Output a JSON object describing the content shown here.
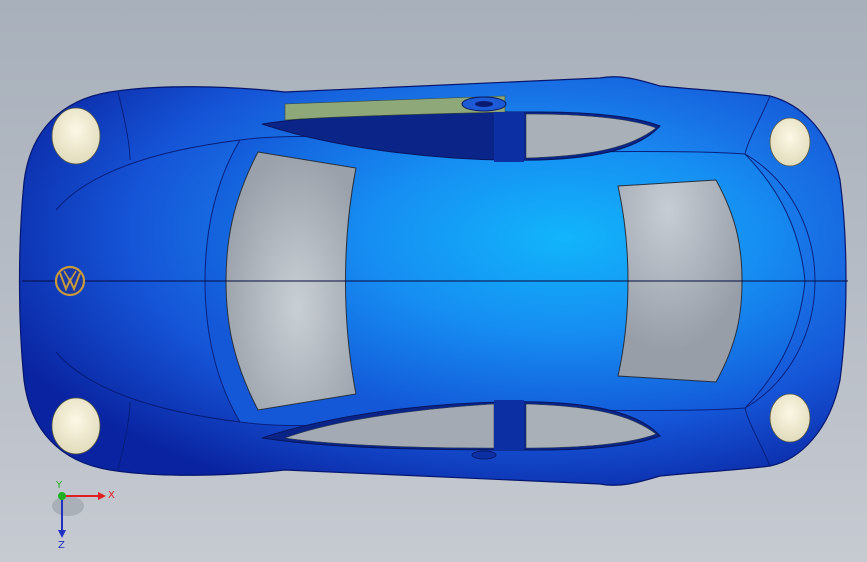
{
  "viewport": {
    "background_top": "#aab2bd",
    "background_bottom": "#c4c9d0"
  },
  "model": {
    "body_color": "#1f6fe0",
    "body_highlight": "#13a6f5",
    "body_dark": "#0b2a9c",
    "glass_color": "#a7aeb6",
    "headlight_color": "#f3efd8",
    "panel_color": "#8fa87a",
    "emblem_color": "#c89a3a"
  },
  "triad": {
    "x_label": "X",
    "y_label": "Y",
    "z_label": "Z",
    "x_color": "#e02020",
    "y_color": "#20b020",
    "z_color": "#2030c0"
  }
}
